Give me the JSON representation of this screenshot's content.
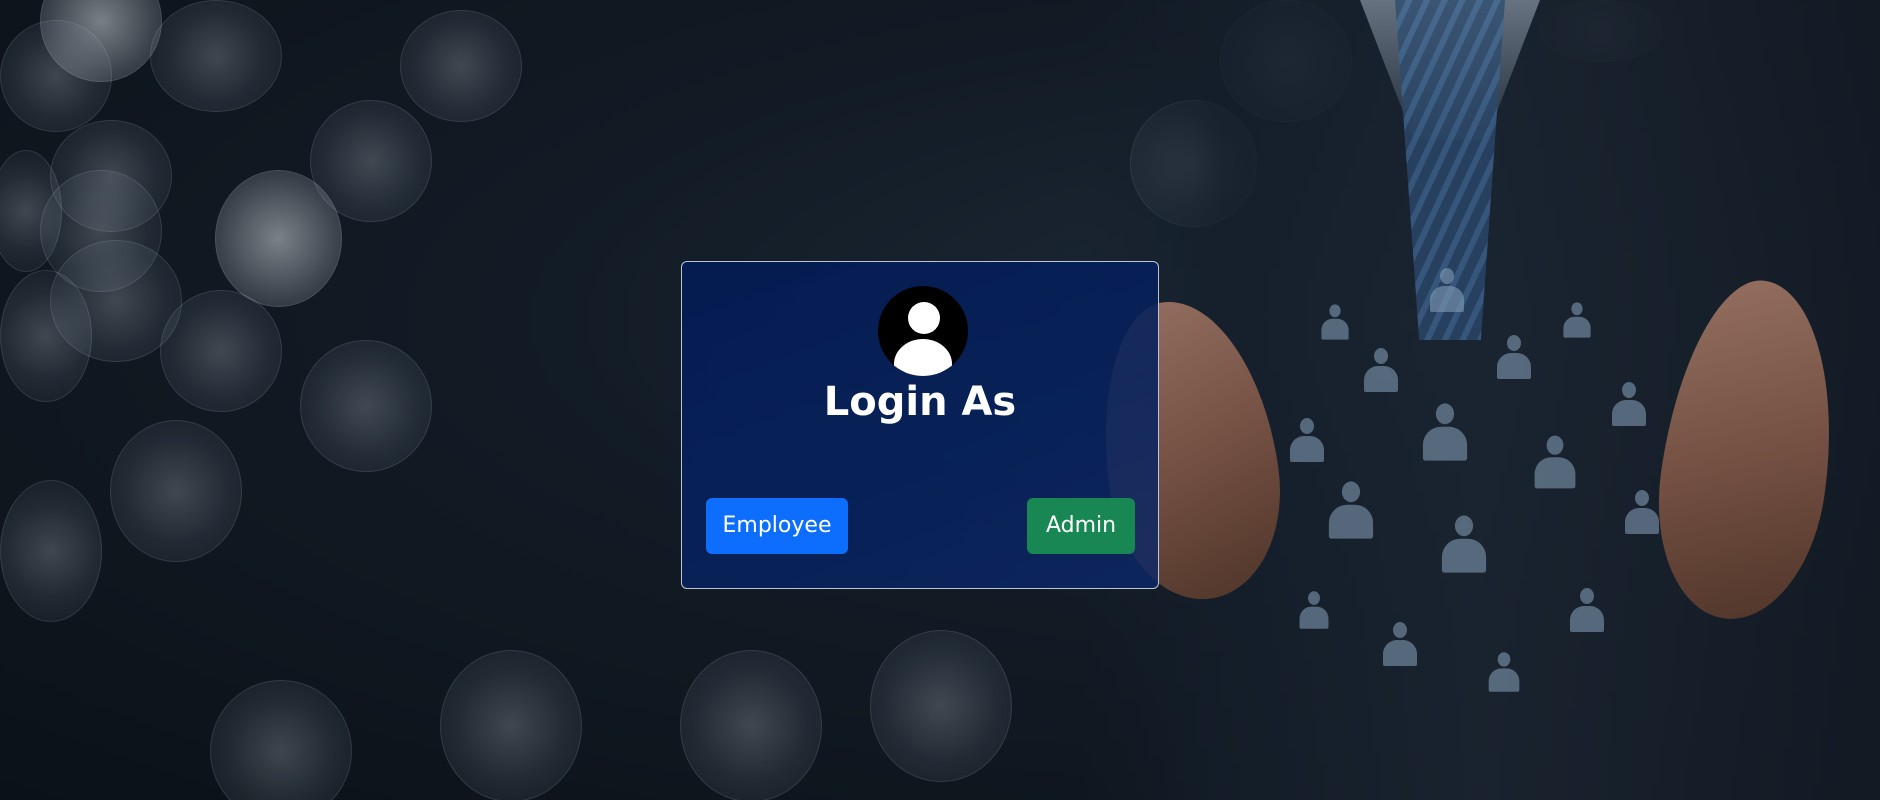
{
  "login_card": {
    "title": "Login As",
    "avatar_icon": "user-avatar-icon",
    "buttons": {
      "employee_label": "Employee",
      "admin_label": "Admin"
    }
  },
  "colors": {
    "card_background": "#06215c",
    "employee_button": "#0d6efd",
    "admin_button": "#198754",
    "text": "#ffffff"
  }
}
